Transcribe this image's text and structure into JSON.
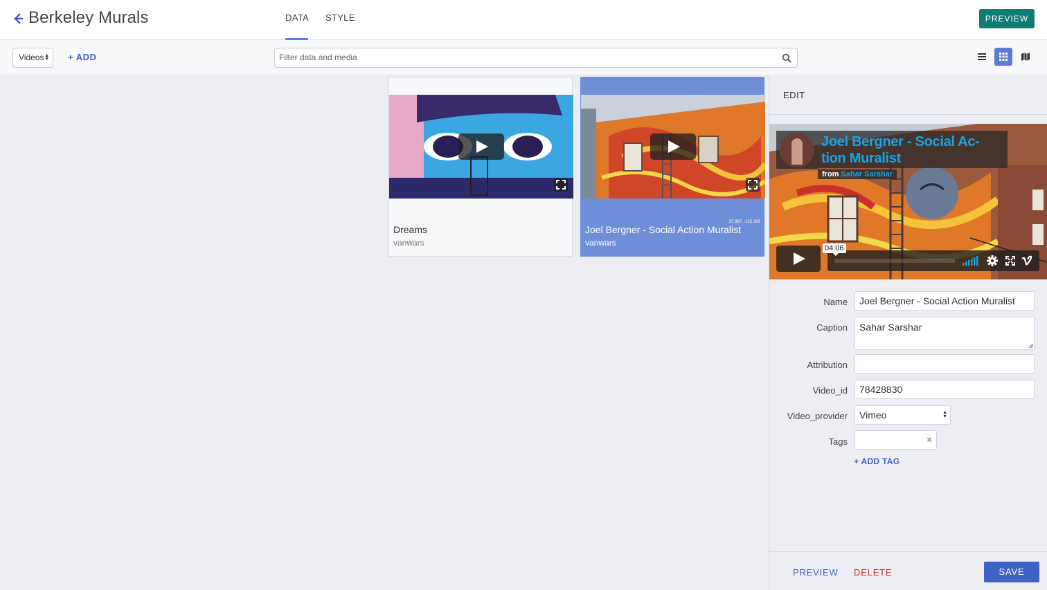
{
  "header": {
    "title": "Berkeley Murals",
    "tabs": [
      {
        "label": "DATA",
        "active": true
      },
      {
        "label": "STYLE",
        "active": false
      }
    ],
    "preview_label": "PREVIEW"
  },
  "toolbar": {
    "type_select_value": "Videos",
    "add_label": "ADD",
    "search_placeholder": "Filter data and media",
    "view_modes": [
      "list",
      "grid",
      "map"
    ],
    "active_view": "grid"
  },
  "cards": [
    {
      "title": "Dreams",
      "subtitle": "vanwars",
      "selected": false
    },
    {
      "title": "Joel Bergner - Social Action Muralist",
      "subtitle": "vanwars",
      "coords": "37.867, -122.303",
      "selected": true
    }
  ],
  "edit": {
    "title": "EDIT",
    "video": {
      "title": "Joel Bergner - Social Ac- tion Muralist",
      "from_prefix": "from",
      "from_name": "Sahar Sarshar",
      "time": "04:06"
    },
    "fields": {
      "name_label": "Name",
      "name_value": "Joel Bergner - Social Action Muralist",
      "caption_label": "Caption",
      "caption_value": "Sahar Sarshar",
      "attribution_label": "Attribution",
      "attribution_value": "",
      "video_id_label": "Video_id",
      "video_id_value": "78428830",
      "provider_label": "Video_provider",
      "provider_value": "Vimeo",
      "tags_label": "Tags",
      "add_tag_label": "ADD TAG"
    },
    "footer": {
      "preview_label": "PREVIEW",
      "delete_label": "DELETE",
      "save_label": "SAVE"
    }
  },
  "colors": {
    "accent": "#3f63c4",
    "selected_card": "#6e8ed8",
    "preview_button": "#0f7c73",
    "delete": "#c52d2f",
    "vimeo_blue": "#17a3e8"
  }
}
